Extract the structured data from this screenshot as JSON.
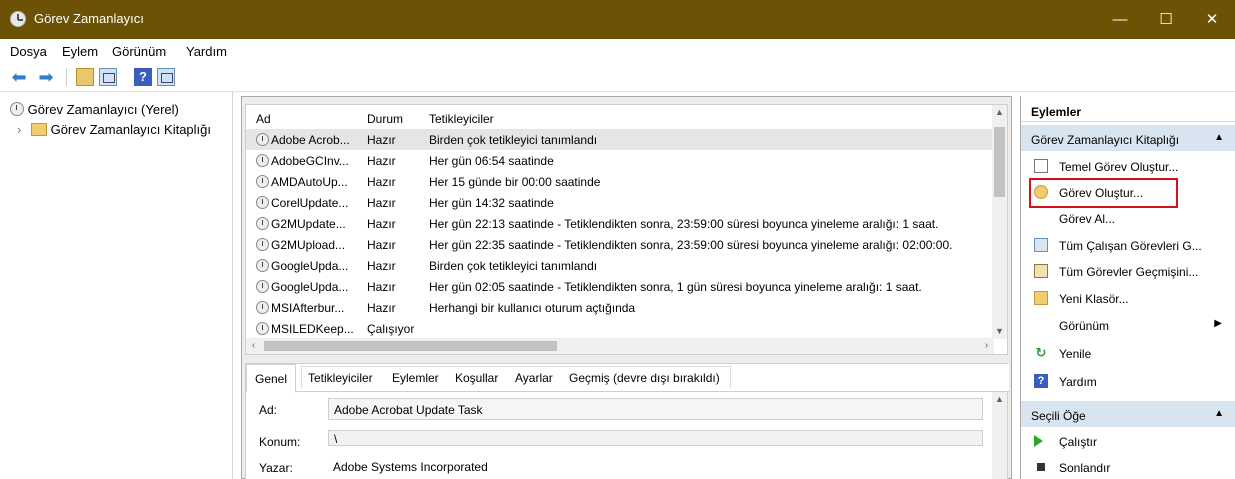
{
  "window": {
    "title": "Görev Zamanlayıcı",
    "controls": {
      "minimize": "—",
      "maximize": "☐",
      "close": "✕"
    }
  },
  "menu": [
    "Dosya",
    "Eylem",
    "Görünüm",
    "Yardım"
  ],
  "toolbar": {
    "back_icon": "⬅",
    "forward_icon": "➡",
    "help_glyph": "?"
  },
  "tree": {
    "root": "Görev Zamanlayıcı (Yerel)",
    "child": "Görev Zamanlayıcı Kitaplığı",
    "expander": "›"
  },
  "task_list": {
    "columns": {
      "name": "Ad",
      "status": "Durum",
      "triggers": "Tetikleyiciler"
    },
    "rows": [
      {
        "name": "Adobe Acrob...",
        "status": "Hazır",
        "trigger": "Birden çok tetikleyici tanımlandı"
      },
      {
        "name": "AdobeGCInv...",
        "status": "Hazır",
        "trigger": "Her gün 06:54 saatinde"
      },
      {
        "name": "AMDAutoUp...",
        "status": "Hazır",
        "trigger": "Her 15 günde bir 00:00 saatinde"
      },
      {
        "name": "CorelUpdate...",
        "status": "Hazır",
        "trigger": "Her gün 14:32 saatinde"
      },
      {
        "name": "G2MUpdate...",
        "status": "Hazır",
        "trigger": "Her gün 22:13 saatinde - Tetiklendikten sonra, 23:59:00 süresi boyunca yineleme aralığı: 1 saat."
      },
      {
        "name": "G2MUpload...",
        "status": "Hazır",
        "trigger": "Her gün 22:35 saatinde - Tetiklendikten sonra, 23:59:00 süresi boyunca yineleme aralığı: 02:00:00."
      },
      {
        "name": "GoogleUpda...",
        "status": "Hazır",
        "trigger": "Birden çok tetikleyici tanımlandı"
      },
      {
        "name": "GoogleUpda...",
        "status": "Hazır",
        "trigger": "Her gün 02:05 saatinde - Tetiklendikten sonra, 1 gün süresi boyunca yineleme aralığı: 1 saat."
      },
      {
        "name": "MSIAfterbur...",
        "status": "Hazır",
        "trigger": "Herhangi bir kullanıcı oturum açtığında"
      },
      {
        "name": "MSILEDKeep...",
        "status": "Çalışıyor",
        "trigger": ""
      }
    ],
    "selected_index": 0,
    "scroll": {
      "up": "▲",
      "down": "▼",
      "left": "‹",
      "right": "›"
    }
  },
  "detail": {
    "tabs": [
      "Genel",
      "Tetikleyiciler",
      "Eylemler",
      "Koşullar",
      "Ayarlar",
      "Geçmiş (devre dışı bırakıldı)"
    ],
    "active_tab": 0,
    "fields": {
      "name_label": "Ad:",
      "name_value": "Adobe Acrobat Update Task",
      "location_label": "Konum:",
      "location_value": "\\",
      "author_label": "Yazar:",
      "author_value": "Adobe Systems Incorporated"
    }
  },
  "actions": {
    "header": "Eylemler",
    "library_section": "Görev Zamanlayıcı Kitaplığı",
    "library_items": [
      "Temel Görev Oluştur...",
      "Görev Oluştur...",
      "Görev Al...",
      "Tüm Çalışan Görevleri G...",
      "Tüm Görevler Geçmişini...",
      "Yeni Klasör...",
      "Görünüm",
      "Yenile",
      "Yardım"
    ],
    "selected_section": "Seçili Öğe",
    "selected_items": [
      "Çalıştır",
      "Sonlandır"
    ],
    "collapse_glyph": "▲",
    "submenu_glyph": "▶"
  }
}
